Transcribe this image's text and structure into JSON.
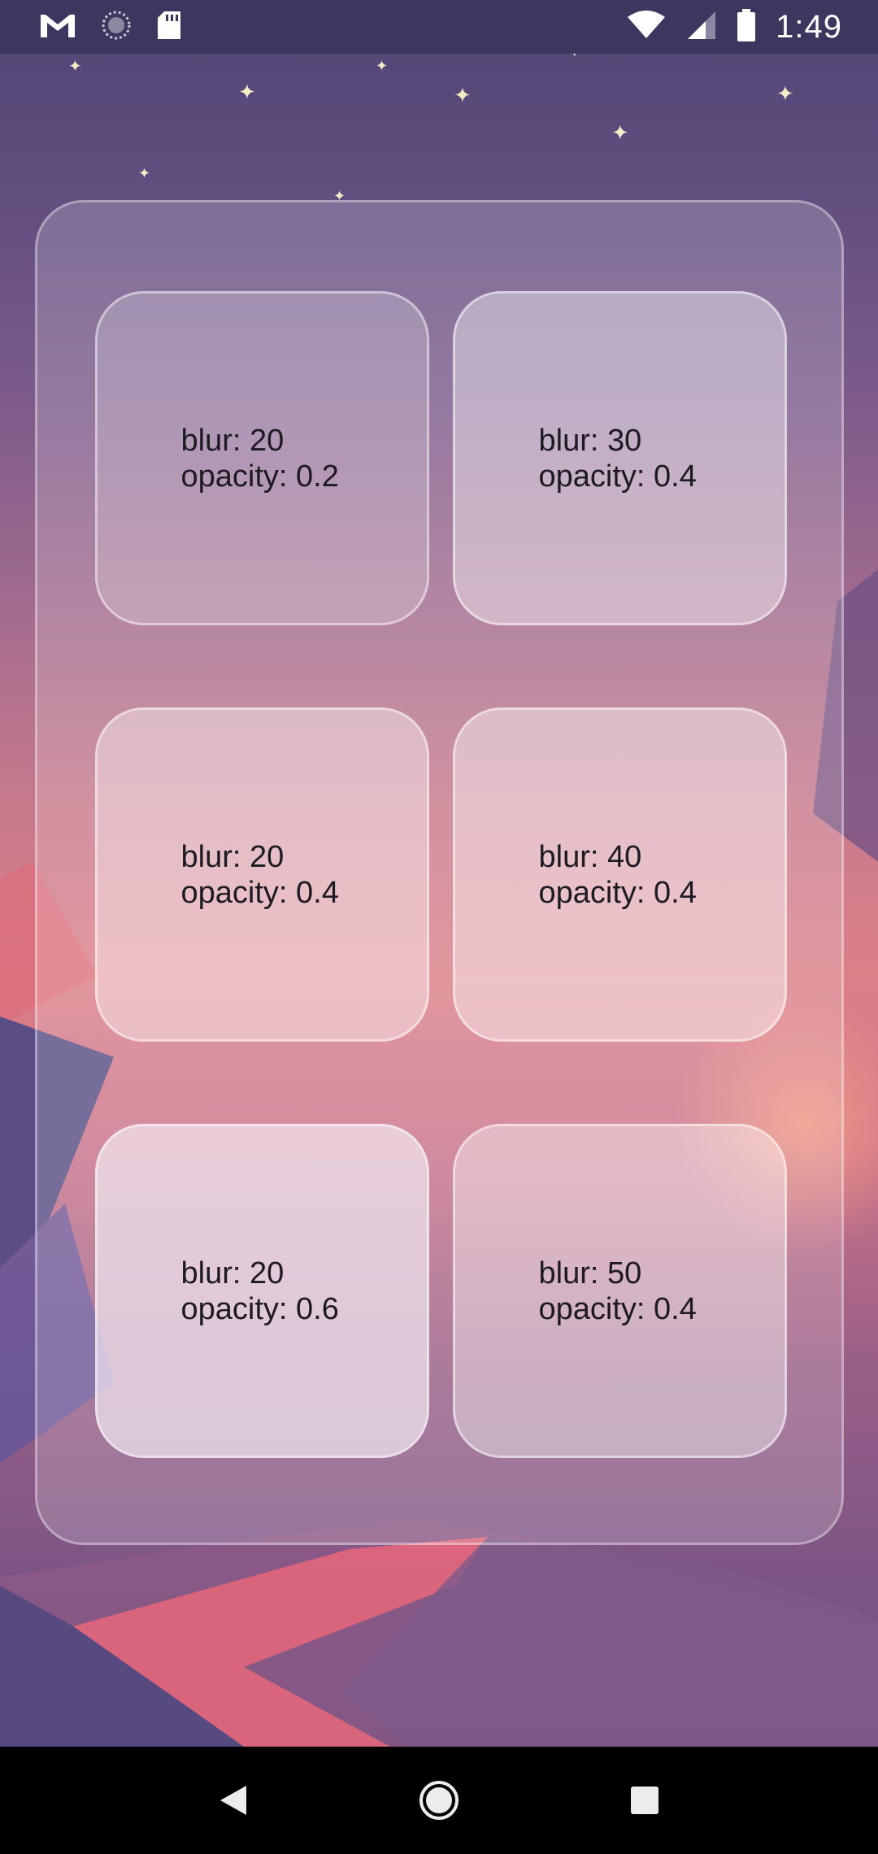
{
  "status_bar": {
    "time": "1:49",
    "left_icons": [
      "gmail-icon",
      "sync-icon",
      "sd-card-icon"
    ],
    "right_icons": [
      "wifi-icon",
      "cell-signal-icon",
      "battery-icon"
    ]
  },
  "tiles": [
    {
      "blur": "blur: 20",
      "opacity": "opacity: 0.2"
    },
    {
      "blur": "blur: 30",
      "opacity": "opacity: 0.4"
    },
    {
      "blur": "blur: 20",
      "opacity": "opacity: 0.4"
    },
    {
      "blur": "blur: 40",
      "opacity": "opacity: 0.4"
    },
    {
      "blur": "blur: 20",
      "opacity": "opacity: 0.6"
    },
    {
      "blur": "blur: 50",
      "opacity": "opacity: 0.4"
    }
  ],
  "nav_bar": {
    "buttons": [
      "back-icon",
      "home-icon",
      "recents-icon"
    ]
  },
  "colors": {
    "status_bar_bg": "#3f3660",
    "nav_bar_bg": "#000000",
    "tile_text": "#1d1a22"
  }
}
